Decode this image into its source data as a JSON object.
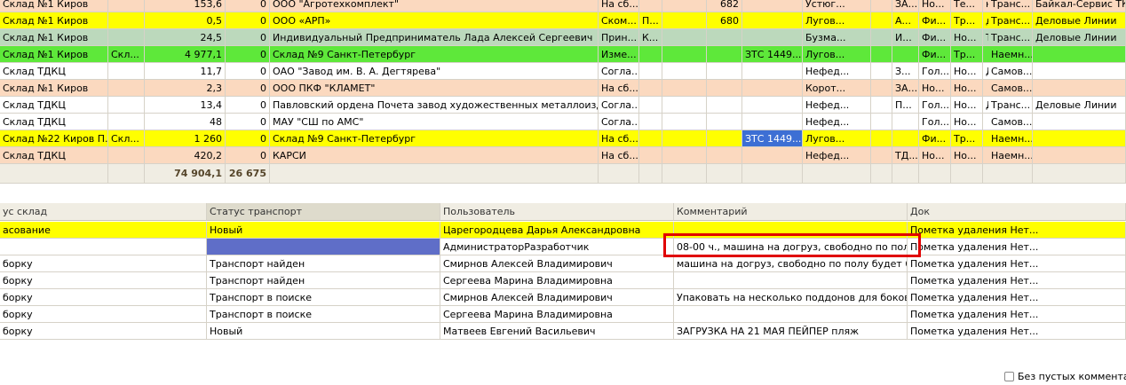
{
  "top_table": {
    "rows": [
      {
        "color": "salmon",
        "c1": "Склад №1 Киров",
        "c2": "",
        "c3": "153,6",
        "c4": "0",
        "c5": "ООО \"Агротехкомплект\"",
        "c6": "На сб...",
        "c7": "",
        "c8": "",
        "c9": "682",
        "c10": "",
        "c11": "Устюг...",
        "c12": "",
        "c13": "ЗА...",
        "c14": "Но...",
        "c15": "Те...",
        "c16": "не т...",
        "c17": "Транс...",
        "c18": "Байкал-Сервис ТК"
      },
      {
        "color": "yellow",
        "c1": "Склад №1 Киров",
        "c2": "",
        "c3": "0,5",
        "c4": "0",
        "c5": "ООО «АРП»",
        "c6": "Ском...",
        "c7": "П...",
        "c8": "",
        "c9": "680",
        "c10": "",
        "c11": "Лугов...",
        "c12": "",
        "c13": "А...",
        "c14": "Фи...",
        "c15": "Тр...",
        "c16": "до ...",
        "c17": "Транс...",
        "c18": "Деловые Линии"
      },
      {
        "color": "sage",
        "c1": "Склад №1 Киров",
        "c2": "",
        "c3": "24,5",
        "c4": "0",
        "c5": "Индивидуальный  Предприниматель Лада Алексей Сергеевич",
        "c6": "Прин...",
        "c7": "К...",
        "c8": "",
        "c9": "",
        "c10": "",
        "c11": "Бузма...",
        "c12": "",
        "c13": "И...",
        "c14": "Фи...",
        "c15": "Но...",
        "c16": "Те...",
        "c17": "Транс...",
        "c18": "Деловые Линии"
      },
      {
        "color": "green",
        "c1": "Склад №1 Киров",
        "c2": "Скл...",
        "c3": "4 977,1",
        "c4": "0",
        "c5": "Склад №9 Санкт-Петербург",
        "c6": "Изме...",
        "c7": "",
        "c8": "",
        "c9": "",
        "c10": "ЗТС 1449...",
        "c11": "Лугов...",
        "c12": "",
        "c13": "",
        "c14": "Фи...",
        "c15": "Тр...",
        "c16": "",
        "c17": "Наемн...",
        "c18": ""
      },
      {
        "color": "white",
        "c1": "Склад ТДКЦ",
        "c2": "",
        "c3": "11,7",
        "c4": "0",
        "c5": "ОАО \"Завод им. В. А. Дегтярева\"",
        "c6": "Согла...",
        "c7": "",
        "c8": "",
        "c9": "",
        "c10": "",
        "c11": "Нефед...",
        "c12": "",
        "c13": "З...",
        "c14": "Гол...",
        "c15": "Но...",
        "c16": "До ...",
        "c17": "Самов...",
        "c18": ""
      },
      {
        "color": "salmon",
        "c1": "Склад №1 Киров",
        "c2": "",
        "c3": "2,3",
        "c4": "0",
        "c5": "ООО ПКФ \"КЛАМЕТ\"",
        "c6": "На сб...",
        "c7": "",
        "c8": "",
        "c9": "",
        "c10": "",
        "c11": "Корот...",
        "c12": "",
        "c13": "ЗА...",
        "c14": "Но...",
        "c15": "Но...",
        "c16": "",
        "c17": "Самов...",
        "c18": ""
      },
      {
        "color": "white",
        "c1": "Склад ТДКЦ",
        "c2": "",
        "c3": "13,4",
        "c4": "0",
        "c5": "Павловский  ордена Почета завод художественных металлоиздели...",
        "c6": "Согла...",
        "c7": "",
        "c8": "",
        "c9": "",
        "c10": "",
        "c11": "Нефед...",
        "c12": "",
        "c13": "П...",
        "c14": "Гол...",
        "c15": "Но...",
        "c16": "До ...",
        "c17": "Транс...",
        "c18": "Деловые Линии"
      },
      {
        "color": "white",
        "c1": "Склад ТДКЦ",
        "c2": "",
        "c3": "48",
        "c4": "0",
        "c5": "МАУ \"СШ по АМС\"",
        "c6": "Согла...",
        "c7": "",
        "c8": "",
        "c9": "",
        "c10": "",
        "c11": "Нефед...",
        "c12": "",
        "c13": "",
        "c14": "Гол...",
        "c15": "Но...",
        "c16": "",
        "c17": "Самов...",
        "c18": ""
      },
      {
        "color": "yellow",
        "c1": "Склад №22 Киров П...",
        "c2": "Скл...",
        "c3": "1 260",
        "c4": "0",
        "c5": "Склад №9 Санкт-Петербург",
        "c6": "На сб...",
        "c7": "",
        "c8": "",
        "c9": "",
        "c10": "ЗТС 1449...",
        "c11": "Лугов...",
        "c12": "",
        "c13": "",
        "c14": "Фи...",
        "c15": "Тр...",
        "c16": "",
        "c17": "Наемн...",
        "c18": ""
      },
      {
        "color": "salmon",
        "c1": "Склад ТДКЦ",
        "c2": "",
        "c3": "420,2",
        "c4": "0",
        "c5": "КАРСИ",
        "c6": "На сб...",
        "c7": "",
        "c8": "",
        "c9": "",
        "c10": "",
        "c11": "Нефед...",
        "c12": "",
        "c13": "ТД...",
        "c14": "Но...",
        "c15": "Но...",
        "c16": "",
        "c17": "Наемн...",
        "c18": ""
      }
    ],
    "totals": {
      "weight": "74 904,1",
      "second": "26 675"
    }
  },
  "filter": {
    "checkbox_label": "Без пустых комментари"
  },
  "bottom_table": {
    "headers": {
      "status_sklad": "ус склад",
      "status_transport": "Статус транспорт",
      "user": "Пользователь",
      "comment": "Комментарий",
      "doc": "Док"
    },
    "rows": [
      {
        "color": "yellow",
        "c1": "асование",
        "c2": "Новый",
        "c3": "Царегородцева Дарья Александровна",
        "c4": "",
        "c5": "Пометка удаления Нет..."
      },
      {
        "color": "white",
        "c1": "",
        "c2": "",
        "c3": "АдминистраторРазработчик",
        "c4": "08-00 ч., машина на догруз, свободно по полу бу...",
        "c5": "Пометка удаления Нет..."
      },
      {
        "color": "white",
        "c1": "борку",
        "c2": "Транспорт найден",
        "c3": "Смирнов Алексей Владимирович",
        "c4": "машина на догруз, свободно по полу будет 6,5 ...",
        "c5": "Пометка удаления Нет..."
      },
      {
        "color": "white",
        "c1": "борку",
        "c2": "Транспорт найден",
        "c3": "Сергеева Марина Владимировна",
        "c4": "",
        "c5": "Пометка удаления Нет..."
      },
      {
        "color": "white",
        "c1": "борку",
        "c2": "Транспорт в поиске",
        "c3": "Смирнов Алексей Владимирович",
        "c4": "Упаковать на несколько поддонов для боковой...",
        "c5": "Пометка удаления Нет..."
      },
      {
        "color": "white",
        "c1": "борку",
        "c2": "Транспорт в поиске",
        "c3": "Сергеева Марина Владимировна",
        "c4": "",
        "c5": "Пометка удаления Нет..."
      },
      {
        "color": "white",
        "c1": "борку",
        "c2": "Новый",
        "c3": "Матвеев Евгений Васильевич",
        "c4": "ЗАГРУЗКА НА 21 МАЯ ПЕЙПЕР пляж",
        "c5": "Пометка удаления Нет..."
      }
    ]
  }
}
